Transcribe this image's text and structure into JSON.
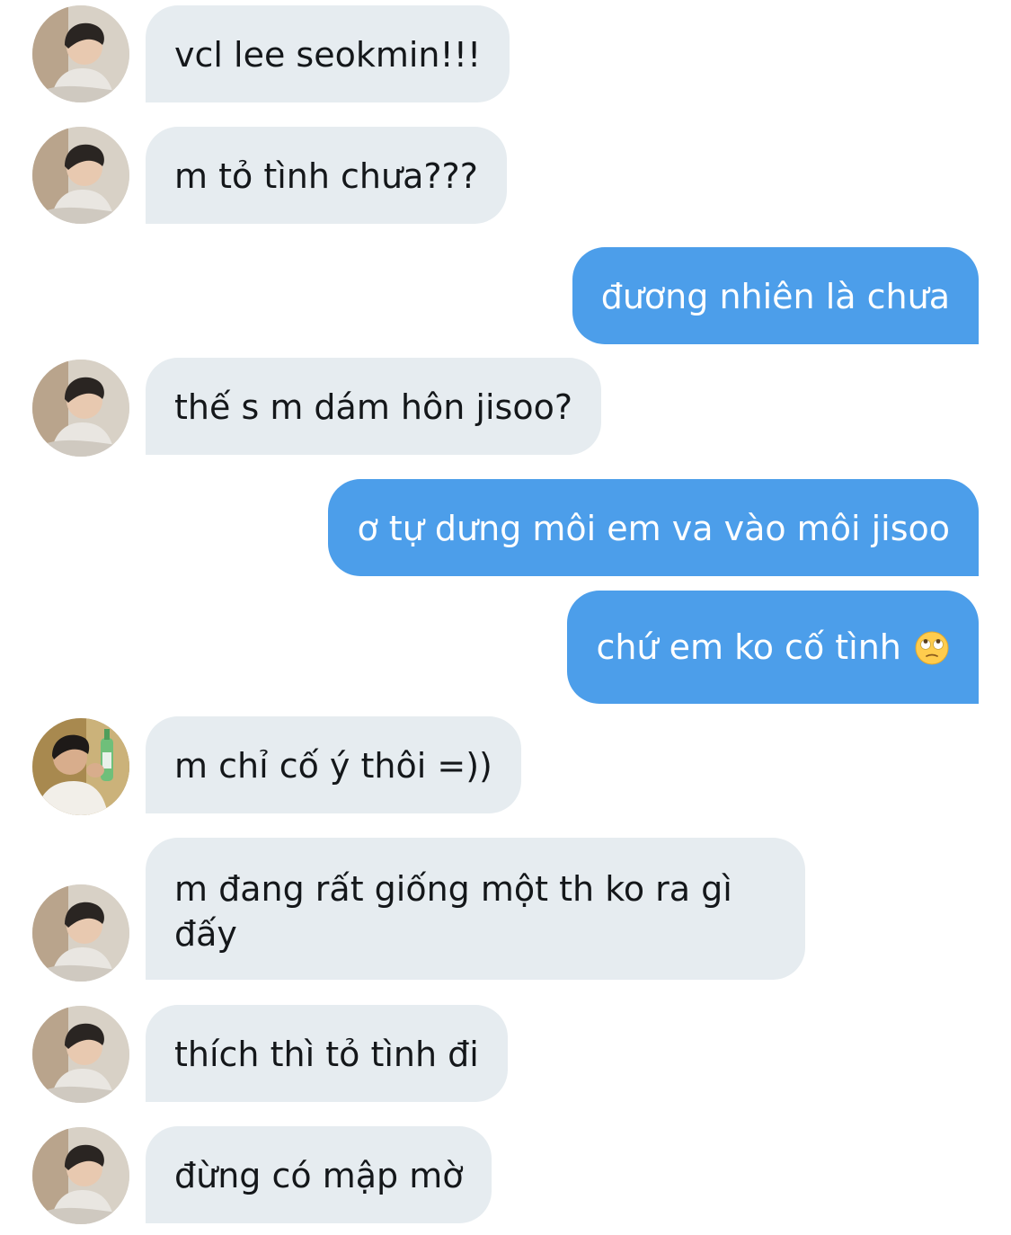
{
  "colors": {
    "incoming_bubble": "#e6ecf0",
    "outgoing_bubble": "#4c9eea",
    "incoming_text": "#14171a",
    "outgoing_text": "#ffffff"
  },
  "messages": [
    {
      "direction": "incoming",
      "avatar": "avatar-seokmin-friend",
      "text": "vcl lee seokmin!!!"
    },
    {
      "direction": "incoming",
      "avatar": "avatar-seokmin-friend",
      "text": "m tỏ tình chưa???"
    },
    {
      "direction": "outgoing",
      "text": "đương nhiên là chưa"
    },
    {
      "direction": "incoming",
      "avatar": "avatar-seokmin-friend",
      "text": "thế s m dám hôn jisoo?"
    },
    {
      "direction": "outgoing",
      "text": "ơ tự dưng môi em va vào môi jisoo"
    },
    {
      "direction": "outgoing",
      "text": "chứ em ko cố tình",
      "emoji": "face-with-rolling-eyes"
    },
    {
      "direction": "incoming",
      "avatar": "avatar-second-friend",
      "text": "m chỉ cố ý thôi =))"
    },
    {
      "direction": "incoming",
      "avatar": "avatar-seokmin-friend",
      "text": "m đang rất giống một th ko ra gì đấy"
    },
    {
      "direction": "incoming",
      "avatar": "avatar-seokmin-friend",
      "text": "thích thì tỏ tình đi"
    },
    {
      "direction": "incoming",
      "avatar": "avatar-seokmin-friend",
      "text": "đừng có mập mờ"
    }
  ]
}
